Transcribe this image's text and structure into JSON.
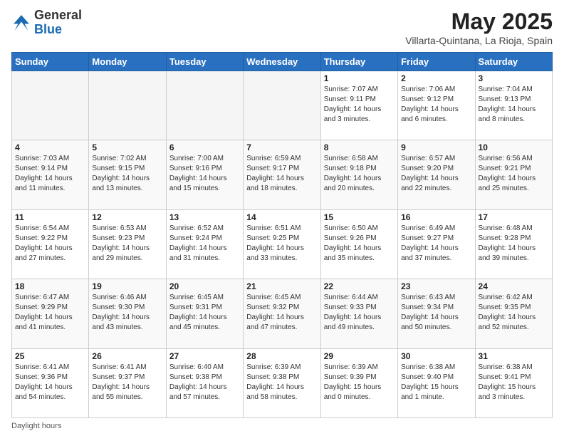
{
  "header": {
    "logo_general": "General",
    "logo_blue": "Blue",
    "month_title": "May 2025",
    "location": "Villarta-Quintana, La Rioja, Spain"
  },
  "days_of_week": [
    "Sunday",
    "Monday",
    "Tuesday",
    "Wednesday",
    "Thursday",
    "Friday",
    "Saturday"
  ],
  "weeks": [
    [
      {
        "num": "",
        "info": ""
      },
      {
        "num": "",
        "info": ""
      },
      {
        "num": "",
        "info": ""
      },
      {
        "num": "",
        "info": ""
      },
      {
        "num": "1",
        "info": "Sunrise: 7:07 AM\nSunset: 9:11 PM\nDaylight: 14 hours\nand 3 minutes."
      },
      {
        "num": "2",
        "info": "Sunrise: 7:06 AM\nSunset: 9:12 PM\nDaylight: 14 hours\nand 6 minutes."
      },
      {
        "num": "3",
        "info": "Sunrise: 7:04 AM\nSunset: 9:13 PM\nDaylight: 14 hours\nand 8 minutes."
      }
    ],
    [
      {
        "num": "4",
        "info": "Sunrise: 7:03 AM\nSunset: 9:14 PM\nDaylight: 14 hours\nand 11 minutes."
      },
      {
        "num": "5",
        "info": "Sunrise: 7:02 AM\nSunset: 9:15 PM\nDaylight: 14 hours\nand 13 minutes."
      },
      {
        "num": "6",
        "info": "Sunrise: 7:00 AM\nSunset: 9:16 PM\nDaylight: 14 hours\nand 15 minutes."
      },
      {
        "num": "7",
        "info": "Sunrise: 6:59 AM\nSunset: 9:17 PM\nDaylight: 14 hours\nand 18 minutes."
      },
      {
        "num": "8",
        "info": "Sunrise: 6:58 AM\nSunset: 9:18 PM\nDaylight: 14 hours\nand 20 minutes."
      },
      {
        "num": "9",
        "info": "Sunrise: 6:57 AM\nSunset: 9:20 PM\nDaylight: 14 hours\nand 22 minutes."
      },
      {
        "num": "10",
        "info": "Sunrise: 6:56 AM\nSunset: 9:21 PM\nDaylight: 14 hours\nand 25 minutes."
      }
    ],
    [
      {
        "num": "11",
        "info": "Sunrise: 6:54 AM\nSunset: 9:22 PM\nDaylight: 14 hours\nand 27 minutes."
      },
      {
        "num": "12",
        "info": "Sunrise: 6:53 AM\nSunset: 9:23 PM\nDaylight: 14 hours\nand 29 minutes."
      },
      {
        "num": "13",
        "info": "Sunrise: 6:52 AM\nSunset: 9:24 PM\nDaylight: 14 hours\nand 31 minutes."
      },
      {
        "num": "14",
        "info": "Sunrise: 6:51 AM\nSunset: 9:25 PM\nDaylight: 14 hours\nand 33 minutes."
      },
      {
        "num": "15",
        "info": "Sunrise: 6:50 AM\nSunset: 9:26 PM\nDaylight: 14 hours\nand 35 minutes."
      },
      {
        "num": "16",
        "info": "Sunrise: 6:49 AM\nSunset: 9:27 PM\nDaylight: 14 hours\nand 37 minutes."
      },
      {
        "num": "17",
        "info": "Sunrise: 6:48 AM\nSunset: 9:28 PM\nDaylight: 14 hours\nand 39 minutes."
      }
    ],
    [
      {
        "num": "18",
        "info": "Sunrise: 6:47 AM\nSunset: 9:29 PM\nDaylight: 14 hours\nand 41 minutes."
      },
      {
        "num": "19",
        "info": "Sunrise: 6:46 AM\nSunset: 9:30 PM\nDaylight: 14 hours\nand 43 minutes."
      },
      {
        "num": "20",
        "info": "Sunrise: 6:45 AM\nSunset: 9:31 PM\nDaylight: 14 hours\nand 45 minutes."
      },
      {
        "num": "21",
        "info": "Sunrise: 6:45 AM\nSunset: 9:32 PM\nDaylight: 14 hours\nand 47 minutes."
      },
      {
        "num": "22",
        "info": "Sunrise: 6:44 AM\nSunset: 9:33 PM\nDaylight: 14 hours\nand 49 minutes."
      },
      {
        "num": "23",
        "info": "Sunrise: 6:43 AM\nSunset: 9:34 PM\nDaylight: 14 hours\nand 50 minutes."
      },
      {
        "num": "24",
        "info": "Sunrise: 6:42 AM\nSunset: 9:35 PM\nDaylight: 14 hours\nand 52 minutes."
      }
    ],
    [
      {
        "num": "25",
        "info": "Sunrise: 6:41 AM\nSunset: 9:36 PM\nDaylight: 14 hours\nand 54 minutes."
      },
      {
        "num": "26",
        "info": "Sunrise: 6:41 AM\nSunset: 9:37 PM\nDaylight: 14 hours\nand 55 minutes."
      },
      {
        "num": "27",
        "info": "Sunrise: 6:40 AM\nSunset: 9:38 PM\nDaylight: 14 hours\nand 57 minutes."
      },
      {
        "num": "28",
        "info": "Sunrise: 6:39 AM\nSunset: 9:38 PM\nDaylight: 14 hours\nand 58 minutes."
      },
      {
        "num": "29",
        "info": "Sunrise: 6:39 AM\nSunset: 9:39 PM\nDaylight: 15 hours\nand 0 minutes."
      },
      {
        "num": "30",
        "info": "Sunrise: 6:38 AM\nSunset: 9:40 PM\nDaylight: 15 hours\nand 1 minute."
      },
      {
        "num": "31",
        "info": "Sunrise: 6:38 AM\nSunset: 9:41 PM\nDaylight: 15 hours\nand 3 minutes."
      }
    ]
  ],
  "footer": {
    "daylight_label": "Daylight hours"
  }
}
